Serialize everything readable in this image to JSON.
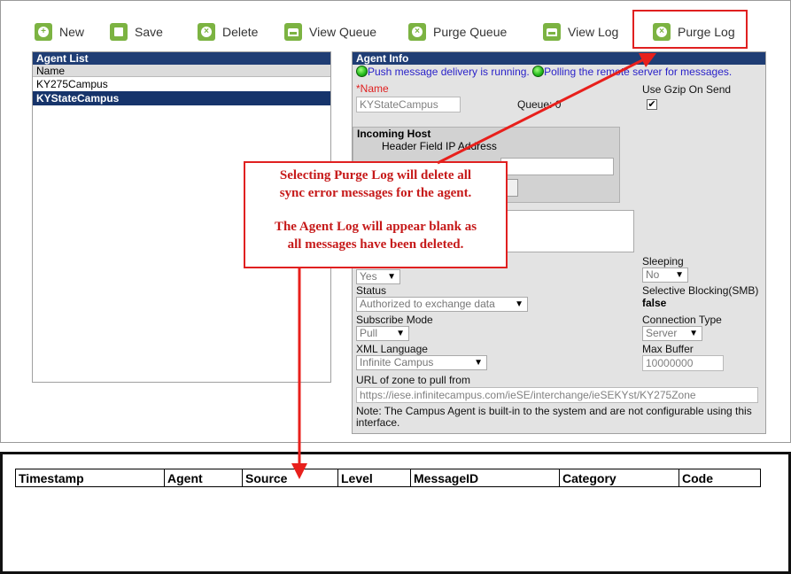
{
  "toolbar": {
    "items": [
      {
        "label": "New",
        "icon": "plus-icon"
      },
      {
        "label": "Save",
        "icon": "save-icon"
      },
      {
        "label": "Delete",
        "icon": "delete-icon"
      },
      {
        "label": "View Queue",
        "icon": "queue-icon"
      },
      {
        "label": "Purge Queue",
        "icon": "purge-icon"
      },
      {
        "label": "View Log",
        "icon": "queue-icon"
      },
      {
        "label": "Purge Log",
        "icon": "purge-icon"
      }
    ],
    "accent_color": "#7cb342",
    "highlight_color": "#e02020"
  },
  "agent_list": {
    "title": "Agent List",
    "column": "Name",
    "rows": [
      "KY275Campus",
      "KYStateCampus"
    ],
    "selected": "KYStateCampus"
  },
  "agent_info": {
    "title": "Agent Info",
    "status_push": "Push message delivery is running.",
    "status_poll": "Polling the remote server for messages.",
    "name_label": "*Name",
    "name_value": "KYStateCampus",
    "queue_label": "Queue: 0",
    "gzip_label": "Use Gzip On Send",
    "gzip_checked": "✔",
    "incoming_host_title": "Incoming Host",
    "header_field_label": "Header Field IP Address",
    "sleeping_label": "Sleeping",
    "sleeping_value": "No",
    "enabled_value": "Yes",
    "status_label": "Status",
    "status_value": "Authorized to exchange data",
    "selective_blocking_label": "Selective Blocking(SMB)",
    "selective_blocking_value": "false",
    "subscribe_mode_label": "Subscribe Mode",
    "subscribe_mode_value": "Pull",
    "connection_type_label": "Connection Type",
    "connection_type_value": "Server",
    "xml_language_label": "XML Language",
    "xml_language_value": "Infinite Campus",
    "max_buffer_label": "Max Buffer",
    "max_buffer_value": "10000000",
    "url_label": "URL of zone to pull from",
    "url_value": "https://iese.infinitecampus.com/ieSE/interchange/ieSEKYst/KY275Zone",
    "note": "Note: The Campus Agent is built-in to the system and are not configurable using this interface."
  },
  "callout": {
    "line1": "Selecting Purge Log will delete all",
    "line2": "sync error messages for the agent.",
    "line3": "The Agent Log will appear blank as",
    "line4": "all messages have been deleted."
  },
  "log_table": {
    "columns": [
      "Timestamp",
      "Agent",
      "Source",
      "Level",
      "MessageID",
      "Category",
      "Code"
    ]
  }
}
